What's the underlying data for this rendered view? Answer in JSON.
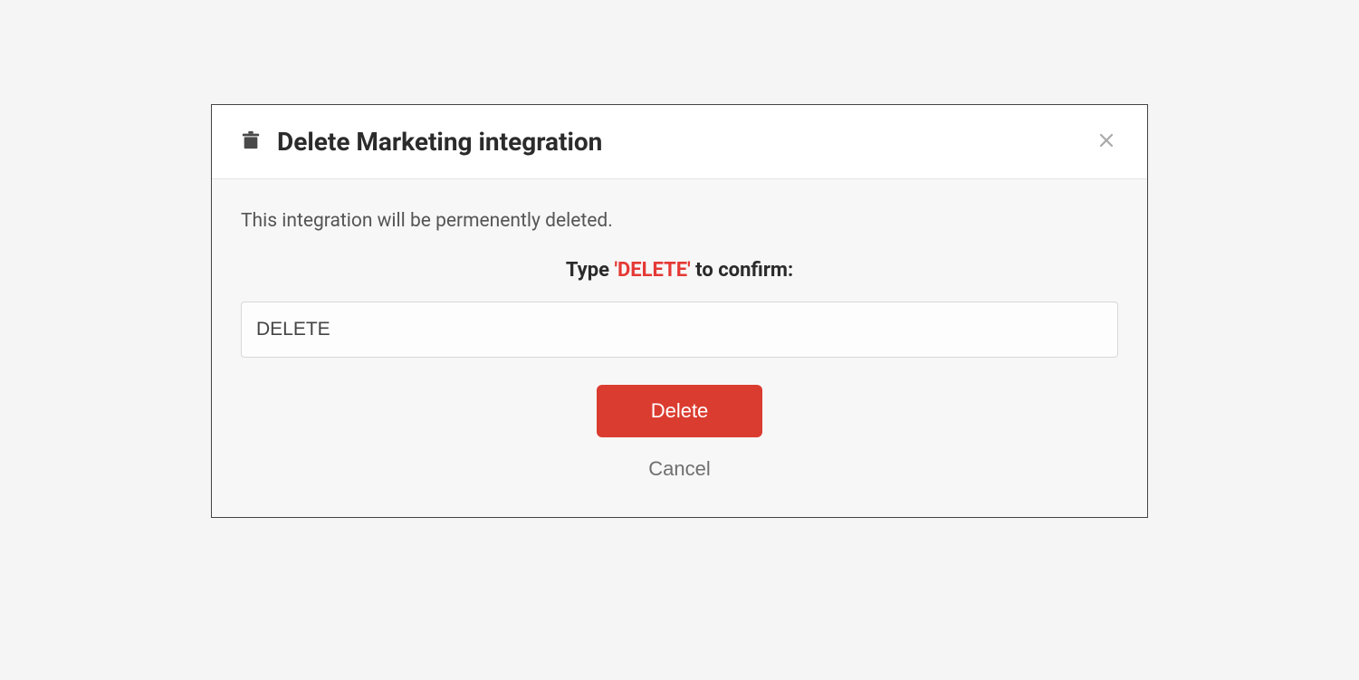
{
  "modal": {
    "title": "Delete Marketing integration",
    "warning_text": "This integration will be permenently deleted.",
    "confirm_prefix": "Type ",
    "confirm_keyword": "'DELETE'",
    "confirm_suffix": " to confirm:",
    "input_value": "DELETE",
    "delete_label": "Delete",
    "cancel_label": "Cancel"
  }
}
